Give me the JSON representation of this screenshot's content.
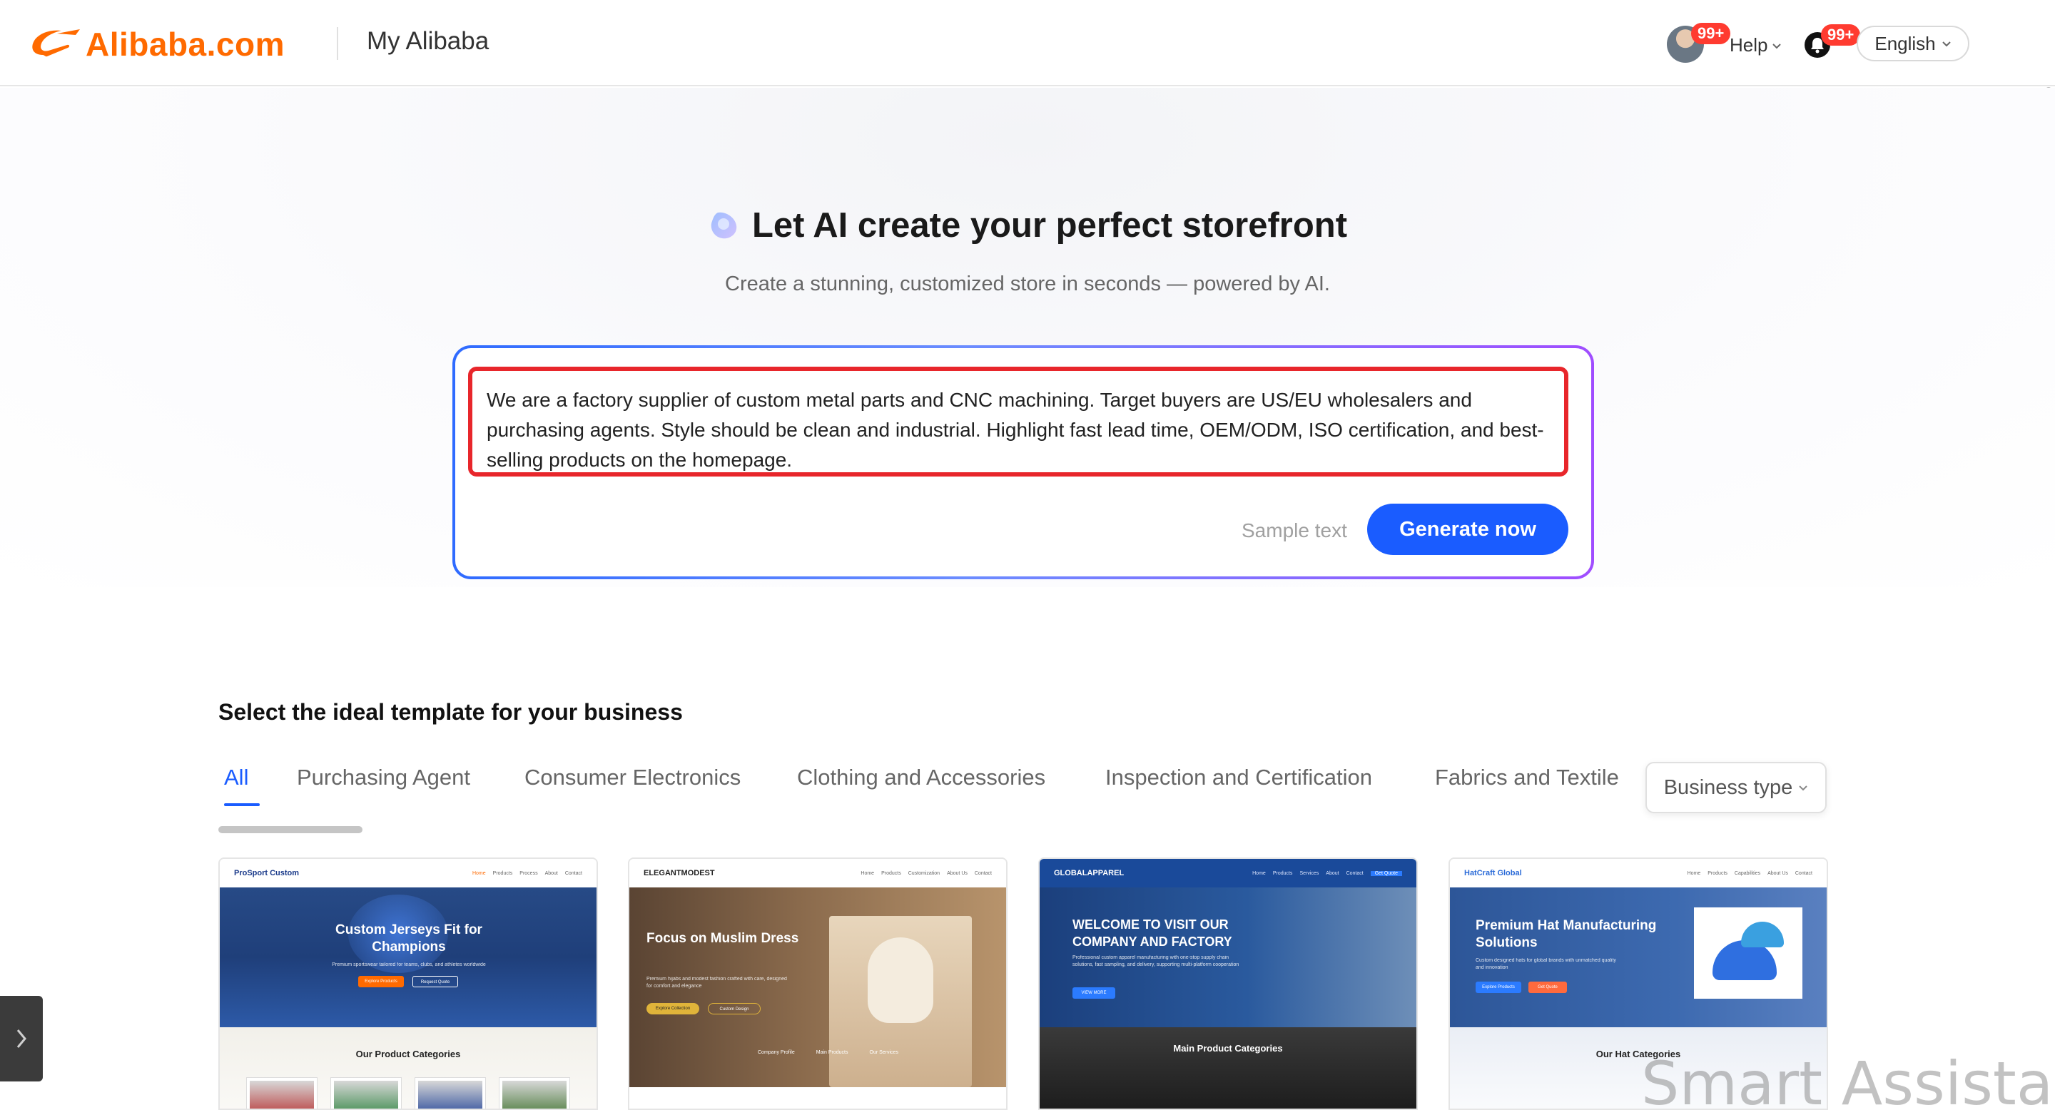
{
  "header": {
    "logo_text": "Alibaba.com",
    "section_title": "My Alibaba",
    "avatar_badge": "99+",
    "help_label": "Help",
    "notification_badge": "99+",
    "language_label": "English"
  },
  "hero": {
    "title": "Let AI create your perfect storefront",
    "subtitle": "Create a stunning, customized store in seconds — powered by AI.",
    "prompt_value": "We are a factory supplier of custom metal parts and CNC machining. Target buyers are US/EU wholesalers and purchasing agents. Style should be clean and industrial. Highlight fast lead time, OEM/ODM, ISO certification, and best-selling products on the homepage.",
    "sample_text_label": "Sample text",
    "generate_label": "Generate now"
  },
  "templates": {
    "section_title": "Select the ideal template for your business",
    "tabs": [
      {
        "label": "All",
        "active": true
      },
      {
        "label": "Purchasing Agent",
        "active": false
      },
      {
        "label": "Consumer Electronics",
        "active": false
      },
      {
        "label": "Clothing and Accessories",
        "active": false
      },
      {
        "label": "Inspection and Certification",
        "active": false
      },
      {
        "label": "Fabrics and Textile",
        "active": false
      }
    ],
    "filter_label": "Business type",
    "cards": [
      {
        "brand": "ProSport Custom",
        "nav": [
          "Home",
          "Products",
          "Process",
          "About",
          "Contact"
        ],
        "headline": "Custom Jerseys Fit for Champions",
        "tagline": "Premium sportswear tailored for teams, clubs, and athletes worldwide",
        "buttons": [
          "Explore Products",
          "Request Quote"
        ],
        "section": "Our Product Categories"
      },
      {
        "brand": "ELEGANTMODEST",
        "nav": [
          "Home",
          "Products",
          "Customization",
          "About Us",
          "Contact"
        ],
        "headline": "Focus on Muslim Dress",
        "tagline": "Premium hijabs and modest fashion crafted with care, designed for comfort and elegance",
        "buttons": [
          "Explore Collection",
          "Custom Design"
        ],
        "footer_links": [
          "Company Profile",
          "Main Products",
          "Our Services"
        ]
      },
      {
        "brand": "GLOBALAPPAREL",
        "nav": [
          "Home",
          "Products",
          "Services",
          "About",
          "Contact"
        ],
        "headline": "WELCOME TO VISIT OUR COMPANY AND FACTORY",
        "tagline": "Professional custom apparel manufacturing with one-stop supply chain solutions, fast sampling, and delivery, supporting multi-platform cooperation",
        "buttons": [
          "VIEW MORE"
        ],
        "nav_button": "Get Quote",
        "section": "Main Product Categories"
      },
      {
        "brand": "HatCraft Global",
        "nav": [
          "Home",
          "Products",
          "Capabilities",
          "About Us",
          "Contact"
        ],
        "headline": "Premium Hat Manufacturing Solutions",
        "tagline": "Custom designed hats for global brands with unmatched quality and innovation",
        "buttons": [
          "Explore Products",
          "Get Quote"
        ],
        "section": "Our Hat Categories"
      }
    ]
  },
  "overlay": {
    "watermark": "Smart Assistant"
  },
  "colors": {
    "brand_orange": "#ff6a00",
    "primary_blue": "#1a5cff",
    "highlight_red": "#e8262b",
    "badge_red": "#ff3b30"
  },
  "icons": [
    "alibaba-logo-icon",
    "chevron-down-icon",
    "bell-icon",
    "ai-sparkle-icon",
    "chevron-right-icon"
  ]
}
